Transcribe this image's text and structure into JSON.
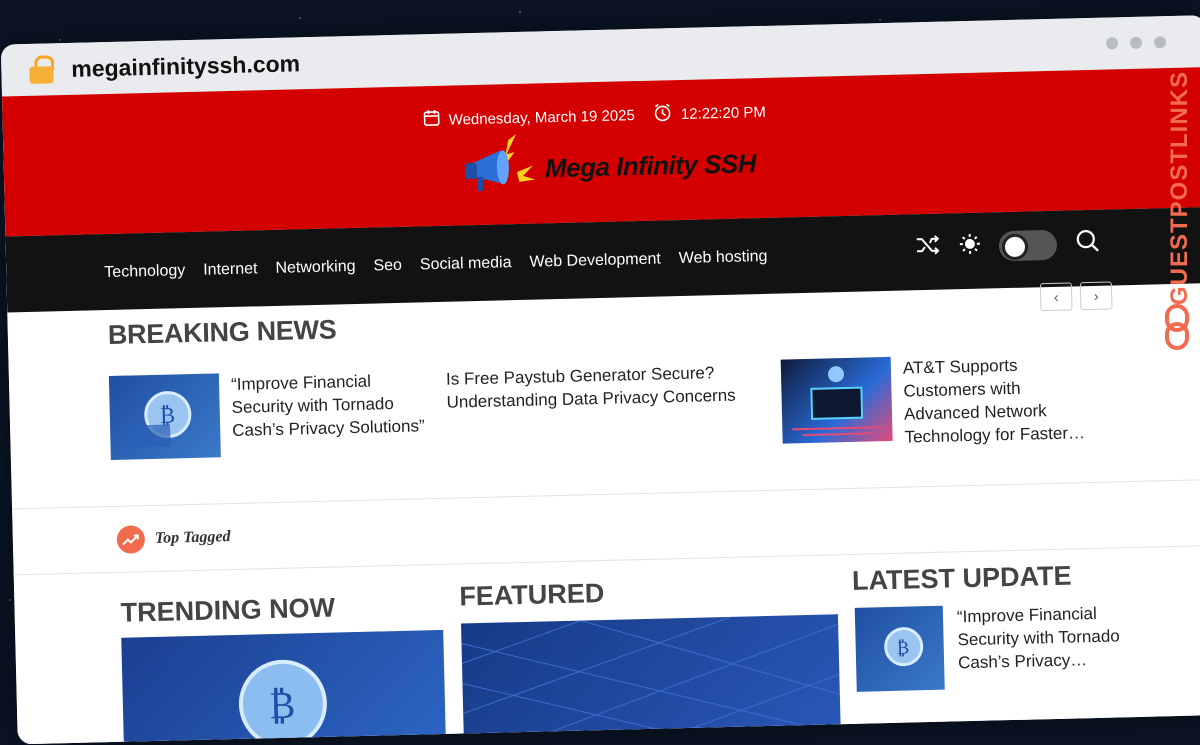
{
  "browser": {
    "url": "megainfinityssh.com"
  },
  "header": {
    "date": "Wednesday, March 19 2025",
    "time": "12:22:20 PM",
    "site_name": "Mega Infinity SSH"
  },
  "nav": {
    "items": [
      "Technology",
      "Internet",
      "Networking",
      "Seo",
      "Social media",
      "Web Development",
      "Web hosting"
    ]
  },
  "breaking": {
    "title": "BREAKING NEWS",
    "items": [
      {
        "text": "“Improve Financial Security with Tornado Cash’s Privacy Solutions”"
      },
      {
        "text": "Is Free Paystub Generator Secure? Understanding Data Privacy Concerns"
      },
      {
        "text": "AT&T Supports Customers with Advanced Network Technology for Faster…"
      }
    ]
  },
  "top_tagged": {
    "label": "Top Tagged"
  },
  "sections": {
    "trending": "TRENDING NOW",
    "featured": "FEATURED",
    "latest": "LATEST UPDATE",
    "latest_item": "“Improve Financial Security with Tornado Cash’s Privacy…"
  },
  "watermark": {
    "text": "GUESTPOSTLINKS"
  },
  "colors": {
    "header_red": "#d40000",
    "nav_black": "#121212",
    "accent_orange": "#f26b4f"
  }
}
